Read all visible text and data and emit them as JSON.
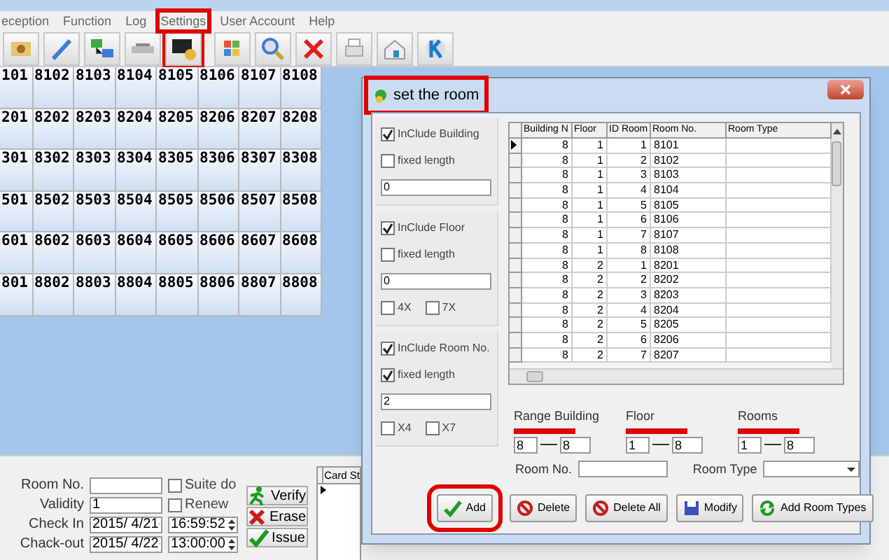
{
  "menu": [
    {
      "label": "eception",
      "selected": false
    },
    {
      "label": "Function",
      "selected": false
    },
    {
      "label": "Log",
      "selected": false
    },
    {
      "label": "Settings",
      "selected": true
    },
    {
      "label": "User Account",
      "selected": false
    },
    {
      "label": "Help",
      "selected": false
    }
  ],
  "room_grid": [
    [
      "101",
      "8102",
      "8103",
      "8104",
      "8105",
      "8106",
      "8107",
      "8108"
    ],
    [
      "201",
      "8202",
      "8203",
      "8204",
      "8205",
      "8206",
      "8207",
      "8208"
    ],
    [
      "301",
      "8302",
      "8303",
      "8304",
      "8305",
      "8306",
      "8307",
      "8308"
    ],
    [
      "501",
      "8502",
      "8503",
      "8504",
      "8505",
      "8506",
      "8507",
      "8508"
    ],
    [
      "601",
      "8602",
      "8603",
      "8604",
      "8605",
      "8606",
      "8607",
      "8608"
    ],
    [
      "801",
      "8802",
      "8803",
      "8804",
      "8805",
      "8806",
      "8807",
      "8808"
    ]
  ],
  "dialog": {
    "title": "set the room",
    "groups": [
      {
        "include": {
          "label": "InClude Building",
          "checked": true
        },
        "fixed": {
          "label": "fixed length",
          "checked": false
        },
        "value": "0"
      },
      {
        "include": {
          "label": "InClude Floor",
          "checked": true
        },
        "fixed": {
          "label": "fixed length",
          "checked": false
        },
        "value": "0",
        "options": [
          {
            "label": "4X",
            "checked": false
          },
          {
            "label": "7X",
            "checked": false
          }
        ]
      },
      {
        "include": {
          "label": "InClude Room No.",
          "checked": true
        },
        "fixed": {
          "label": "fixed length",
          "checked": true
        },
        "value": "2",
        "options": [
          {
            "label": "X4",
            "checked": false
          },
          {
            "label": "X7",
            "checked": false
          }
        ]
      }
    ],
    "table": {
      "columns": [
        "Building N",
        "Floor",
        "ID Room",
        "Room No.",
        "Room Type"
      ],
      "rows": [
        {
          "cells": [
            "8",
            "1",
            "1",
            "8101"
          ],
          "selected": true
        },
        {
          "cells": [
            "8",
            "1",
            "2",
            "8102"
          ],
          "selected": false
        },
        {
          "cells": [
            "8",
            "1",
            "3",
            "8103"
          ],
          "selected": false
        },
        {
          "cells": [
            "8",
            "1",
            "4",
            "8104"
          ],
          "selected": false
        },
        {
          "cells": [
            "8",
            "1",
            "5",
            "8105"
          ],
          "selected": false
        },
        {
          "cells": [
            "8",
            "1",
            "6",
            "8106"
          ],
          "selected": false
        },
        {
          "cells": [
            "8",
            "1",
            "7",
            "8107"
          ],
          "selected": false
        },
        {
          "cells": [
            "8",
            "1",
            "8",
            "8108"
          ],
          "selected": false
        },
        {
          "cells": [
            "8",
            "2",
            "1",
            "8201"
          ],
          "selected": false
        },
        {
          "cells": [
            "8",
            "2",
            "2",
            "8202"
          ],
          "selected": false
        },
        {
          "cells": [
            "8",
            "2",
            "3",
            "8203"
          ],
          "selected": false
        },
        {
          "cells": [
            "8",
            "2",
            "4",
            "8204"
          ],
          "selected": false
        },
        {
          "cells": [
            "8",
            "2",
            "5",
            "8205"
          ],
          "selected": false
        },
        {
          "cells": [
            "8",
            "2",
            "6",
            "8206"
          ],
          "selected": false
        },
        {
          "cells": [
            "8",
            "2",
            "7",
            "8207"
          ],
          "selected": false
        }
      ]
    },
    "ranges": [
      {
        "label": "Range Building",
        "from": "8",
        "to": "8"
      },
      {
        "label": "Floor",
        "from": "1",
        "to": "8"
      },
      {
        "label": "Rooms",
        "from": "1",
        "to": "8"
      }
    ],
    "room_no_label": "Room No.",
    "room_type_label": "Room Type",
    "buttons": [
      {
        "label": "Add",
        "kind": "check"
      },
      {
        "label": "Delete",
        "kind": "ban"
      },
      {
        "label": "Delete All",
        "kind": "ban"
      },
      {
        "label": "Modify",
        "kind": "save"
      },
      {
        "label": "Add Room Types",
        "kind": "refresh"
      }
    ]
  },
  "card_form": {
    "room_no_label": "Room No.",
    "suite": {
      "label": "Suite do",
      "checked": false
    },
    "validity_label": "Validity",
    "validity": "1",
    "renew": {
      "label": "Renew",
      "checked": false
    },
    "check_in_label": "Check In",
    "check_in_date": "2015/ 4/21",
    "check_in_time": "16:59:52",
    "check_out_label": "Chack-out",
    "check_out_date": "2015/ 4/22",
    "check_out_time": "13:00:00",
    "actions": [
      {
        "label": "Verify",
        "kind": "run"
      },
      {
        "label": "Erase",
        "kind": "cross"
      },
      {
        "label": "Issue",
        "kind": "check"
      }
    ],
    "card_column": "Card St"
  }
}
